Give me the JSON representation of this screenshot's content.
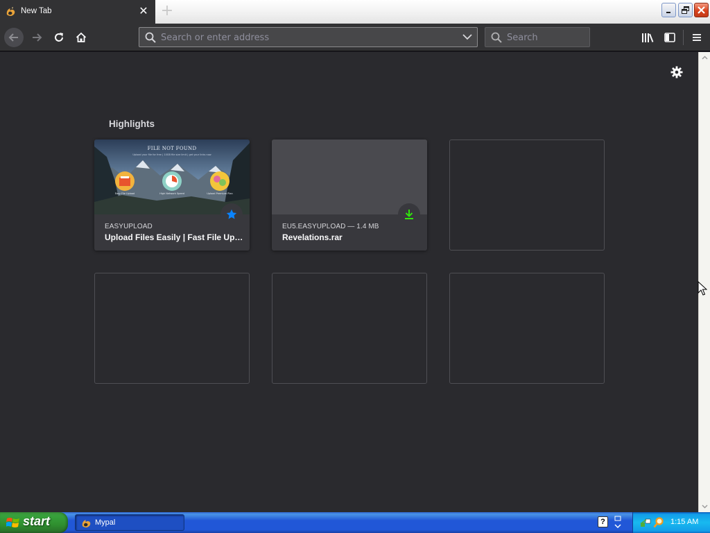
{
  "browser": {
    "tab": {
      "title": "New Tab",
      "favicon": "firefox-logo",
      "close_icon": "close-icon"
    },
    "new_tab_icon": "plus-icon",
    "window_controls": [
      "minimize-icon",
      "restore-icon",
      "close-icon"
    ],
    "toolbar": {
      "back_icon": "back-arrow-icon",
      "forward_icon": "forward-arrow-icon",
      "reload_icon": "reload-icon",
      "home_icon": "home-icon",
      "url_placeholder": "Search or enter address",
      "url_value": "",
      "search_placeholder": "Search",
      "library_icon": "library-icon",
      "sidebar_icon": "sidebar-icon",
      "menu_icon": "hamburger-menu-icon"
    }
  },
  "newtab": {
    "settings_icon": "gear-icon",
    "section_title": "Highlights",
    "cards": [
      {
        "host": "EASYUPLOAD",
        "title": "Upload Files Easily | Fast File Upl...",
        "badge": "bookmark-star-icon",
        "thumb": {
          "heading": "FILE NOT FOUND",
          "subtext": "Upload your file for free | 10GB file size limit | get your links now",
          "features": [
            "Easy File Upload",
            "High Network Speed",
            "Upload Premium Plan"
          ]
        }
      },
      {
        "host": "EU5.EASYUPLOAD — 1.4 MB",
        "title": "Revelations.rar",
        "badge": "download-icon"
      }
    ],
    "empty_slots": 4
  },
  "taskbar": {
    "start_label": "start",
    "task_label": "Mypal",
    "help_label": "?",
    "clock": "1:15 AM"
  },
  "colors": {
    "content_bg": "#2a2a2e",
    "toolbar_bg": "#323234",
    "star_blue": "#0a84ff",
    "download_green": "#30e60b",
    "taskbar_blue": "#2157d7",
    "start_green": "#37a13b"
  }
}
